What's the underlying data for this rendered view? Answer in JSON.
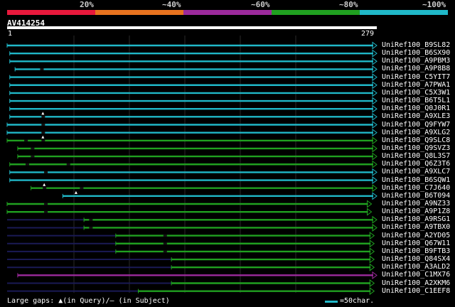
{
  "colors": {
    "bands": [
      "#e8193c",
      "#e8731f",
      "#9c2a9c",
      "#20a020",
      "#20b8c8"
    ],
    "dim_line": "#1a1a55",
    "grid": "#2a2a2a"
  },
  "legend": {
    "labels": [
      "20%",
      "~40%",
      "~60%",
      "~80%",
      "~100%"
    ]
  },
  "query": {
    "name": "AV414254",
    "start": "1",
    "end": "279",
    "length": 279
  },
  "hits": [
    {
      "name": "UniRef100_B9SL82",
      "color": "#20b8c8",
      "qs": 0,
      "qe": 279,
      "gaps": []
    },
    {
      "name": "UniRef100_B6SX90",
      "color": "#20b8c8",
      "qs": 2,
      "qe": 279,
      "gaps": []
    },
    {
      "name": "UniRef100_A9PBM3",
      "color": "#20b8c8",
      "qs": 2,
      "qe": 279,
      "gaps": []
    },
    {
      "name": "UniRef100_A9P8B8",
      "color": "#20b8c8",
      "qs": 6,
      "qe": 279,
      "gaps": [
        26
      ]
    },
    {
      "name": "UniRef100_C5YIT7",
      "color": "#20b8c8",
      "qs": 2,
      "qe": 279,
      "gaps": []
    },
    {
      "name": "UniRef100_A7PWA1",
      "color": "#20b8c8",
      "qs": 2,
      "qe": 279,
      "gaps": []
    },
    {
      "name": "UniRef100_C5X3W1",
      "color": "#20b8c8",
      "qs": 2,
      "qe": 279,
      "gaps": []
    },
    {
      "name": "UniRef100_B6T5L1",
      "color": "#20b8c8",
      "qs": 2,
      "qe": 279,
      "gaps": []
    },
    {
      "name": "UniRef100_Q0J0R1",
      "color": "#20b8c8",
      "qs": 2,
      "qe": 279,
      "gaps": []
    },
    {
      "name": "UniRef100_A9XLE3",
      "color": "#20b8c8",
      "qs": 2,
      "qe": 279,
      "gaps": [
        27
      ],
      "ins": [
        27
      ]
    },
    {
      "name": "UniRef100_Q9FYW7",
      "color": "#20b8c8",
      "qs": 0,
      "qe": 279,
      "gaps": [
        27
      ]
    },
    {
      "name": "UniRef100_A9XLG2",
      "color": "#20b8c8",
      "qs": 0,
      "qe": 279,
      "gaps": [
        27
      ]
    },
    {
      "name": "UniRef100_Q9SLC8",
      "color": "#20a020",
      "qs": 0,
      "qe": 279,
      "gaps": [
        14,
        27
      ],
      "ins": [
        27
      ]
    },
    {
      "name": "UniRef100_Q9SVZ3",
      "color": "#20a020",
      "qs": 8,
      "qe": 279,
      "gaps": [
        19
      ]
    },
    {
      "name": "UniRef100_Q8L3S7",
      "color": "#20a020",
      "qs": 8,
      "qe": 279,
      "gaps": [
        19
      ]
    },
    {
      "name": "UniRef100_Q6Z3T6",
      "color": "#20a020",
      "qs": 2,
      "qe": 279,
      "gaps": [
        15,
        46
      ]
    },
    {
      "name": "UniRef100_A9XLC7",
      "color": "#20b8c8",
      "qs": 2,
      "qe": 279,
      "gaps": [
        29
      ]
    },
    {
      "name": "UniRef100_B6SQW1",
      "color": "#20b8c8",
      "qs": 2,
      "qe": 279,
      "gaps": []
    },
    {
      "name": "UniRef100_C7J640",
      "color": "#20a020",
      "qs": 18,
      "qe": 279,
      "gaps": [
        28,
        56
      ],
      "ins": [
        28
      ]
    },
    {
      "name": "UniRef100_B6T094",
      "color": "#20b8c8",
      "qs": 42,
      "qe": 279,
      "gaps": [],
      "ins": [
        52
      ]
    },
    {
      "name": "UniRef100_A9NZ33",
      "color": "#20a020",
      "qs": 0,
      "qe": 275,
      "gaps": [
        29
      ]
    },
    {
      "name": "UniRef100_A9P1Z8",
      "color": "#20a020",
      "qs": 0,
      "qe": 275,
      "gaps": [
        29
      ]
    },
    {
      "name": "UniRef100_A9RSG1",
      "color": "#20a020",
      "qs": 58,
      "qe": 279,
      "gaps": [
        63
      ],
      "dim": [
        [
          0,
          58
        ]
      ]
    },
    {
      "name": "UniRef100_A9TBX0",
      "color": "#20a020",
      "qs": 58,
      "qe": 279,
      "gaps": [
        63
      ],
      "dim": [
        [
          0,
          58
        ]
      ]
    },
    {
      "name": "UniRef100_A2YD05",
      "color": "#20a020",
      "qs": 82,
      "qe": 277,
      "gaps": [
        119
      ],
      "dim": [
        [
          0,
          82
        ]
      ]
    },
    {
      "name": "UniRef100_Q67W11",
      "color": "#20a020",
      "qs": 82,
      "qe": 277,
      "gaps": [
        119
      ],
      "dim": [
        [
          0,
          82
        ]
      ]
    },
    {
      "name": "UniRef100_B9FTB3",
      "color": "#20a020",
      "qs": 82,
      "qe": 277,
      "gaps": [
        119
      ],
      "dim": [
        [
          0,
          82
        ]
      ]
    },
    {
      "name": "UniRef100_Q84SX4",
      "color": "#20a020",
      "qs": 124,
      "qe": 277,
      "gaps": [],
      "dim": [
        [
          0,
          124
        ]
      ]
    },
    {
      "name": "UniRef100_A3ALD2",
      "color": "#20a020",
      "qs": 124,
      "qe": 277,
      "gaps": [],
      "dim": [
        [
          0,
          124
        ]
      ]
    },
    {
      "name": "UniRef100_C1MX76",
      "color": "#9c2a9c",
      "qs": 8,
      "qe": 279,
      "gaps": []
    },
    {
      "name": "UniRef100_A2XKM6",
      "color": "#20a020",
      "qs": 124,
      "qe": 277,
      "gaps": [],
      "dim": [
        [
          0,
          124
        ]
      ]
    },
    {
      "name": "UniRef100_C1EEF8",
      "color": "#20a020",
      "qs": 99,
      "qe": 277,
      "gaps": [],
      "dim": [
        [
          0,
          99
        ]
      ]
    }
  ],
  "footer": {
    "text": "Large gaps: ▲(in Query)/‒ (in Subject)"
  },
  "scale": {
    "label": "=50char.",
    "color": "#20b8c8"
  }
}
